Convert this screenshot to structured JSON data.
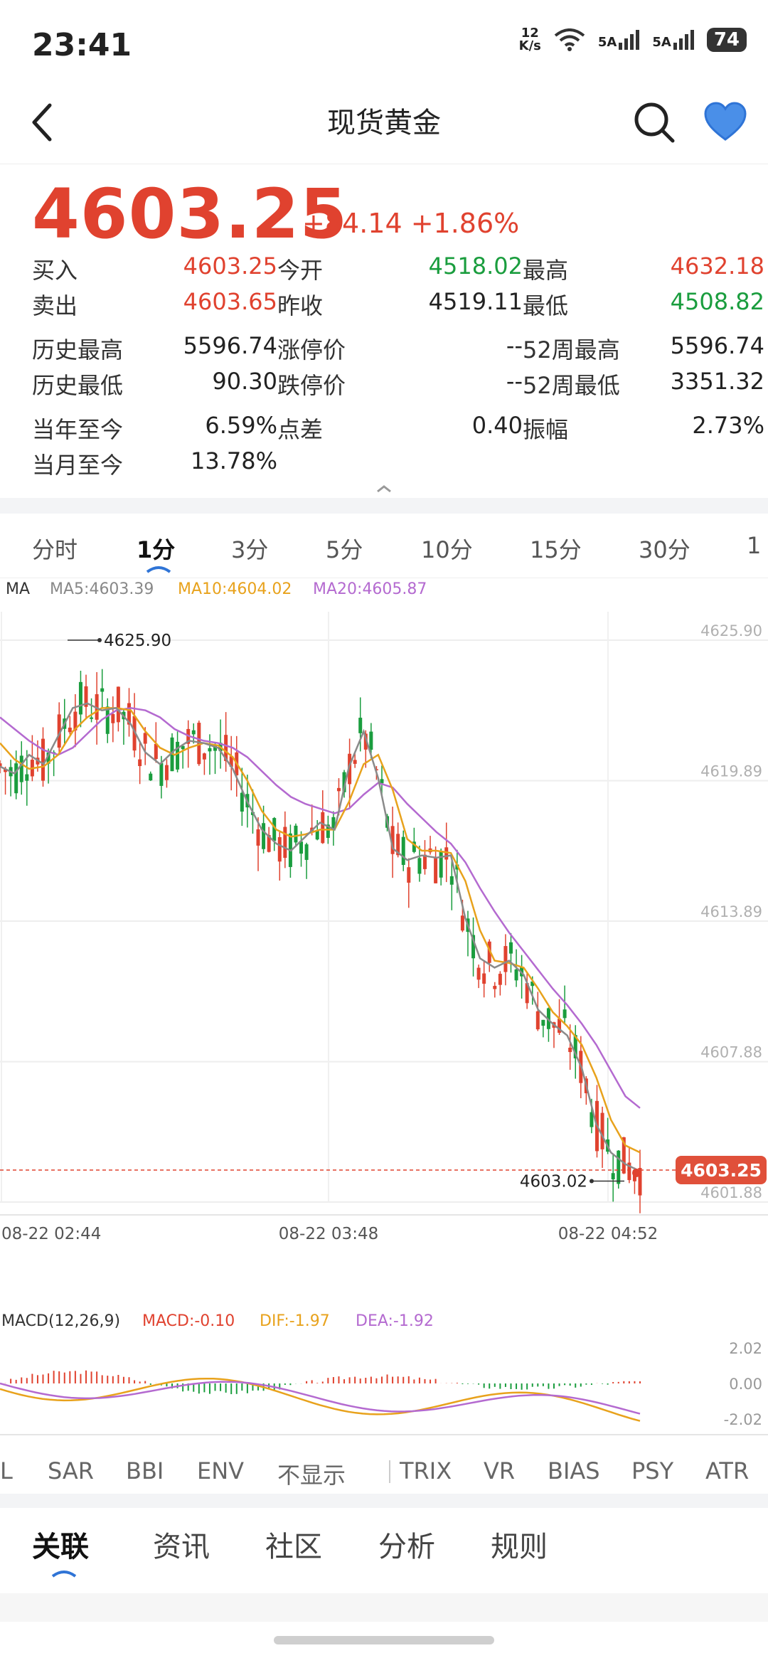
{
  "status_bar": {
    "time": "23:41",
    "net_speed": "12\nK/s",
    "signal1": "5A",
    "signal2": "5A",
    "battery": "74"
  },
  "header": {
    "title": "现货黄金"
  },
  "quote": {
    "price": "4603.25",
    "change": "+84.14 +1.86%",
    "colors": {
      "up": "#e0422f",
      "down": "#1a9d3e"
    },
    "stats": [
      [
        {
          "label": "买入",
          "value": "4603.25",
          "color": "red"
        },
        {
          "label": "今开",
          "value": "4518.02",
          "color": "green"
        },
        {
          "label": "最高",
          "value": "4632.18",
          "color": "red"
        }
      ],
      [
        {
          "label": "卖出",
          "value": "4603.65",
          "color": "red"
        },
        {
          "label": "昨收",
          "value": "4519.11",
          "color": "blk"
        },
        {
          "label": "最低",
          "value": "4508.82",
          "color": "green"
        }
      ],
      [
        {
          "label": "历史最高",
          "value": "5596.74",
          "color": "blk"
        },
        {
          "label": "涨停价",
          "value": "--",
          "color": "blk"
        },
        {
          "label": "52周最高",
          "value": "5596.74",
          "color": "blk"
        }
      ],
      [
        {
          "label": "历史最低",
          "value": "90.30",
          "color": "blk"
        },
        {
          "label": "跌停价",
          "value": "--",
          "color": "blk"
        },
        {
          "label": "52周最低",
          "value": "3351.32",
          "color": "blk"
        }
      ],
      [
        {
          "label": "当年至今",
          "value": "6.59%",
          "color": "blk"
        },
        {
          "label": "点差",
          "value": "0.40",
          "color": "blk"
        },
        {
          "label": "振幅",
          "value": "2.73%",
          "color": "blk"
        }
      ],
      [
        {
          "label": "当月至今",
          "value": "13.78%",
          "color": "blk"
        }
      ]
    ]
  },
  "period_tabs": [
    "分时",
    "1分",
    "3分",
    "5分",
    "10分",
    "15分",
    "30分",
    "1"
  ],
  "period_active": "1分",
  "ma_legend": {
    "label": "MA",
    "ma5": "MA5:4603.39",
    "ma10": "MA10:4604.02",
    "ma20": "MA20:4605.87"
  },
  "chart_data": {
    "type": "candlestick",
    "y_ticks": [
      "4625.90",
      "4619.89",
      "4613.89",
      "4607.88",
      "4601.88"
    ],
    "x_ticks": [
      "08-22 02:44",
      "08-22 03:48",
      "08-22 04:52"
    ],
    "high_label": "4625.90",
    "low_label": "4603.02",
    "current_label": "4603.25",
    "ylim": [
      4601.88,
      4625.9
    ],
    "ma5_series": [
      4620.5,
      4620.2,
      4621.0,
      4620.6,
      4621.8,
      4623.0,
      4623.2,
      4622.9,
      4623.0,
      4622.3,
      4621.1,
      4620.6,
      4621.2,
      4621.6,
      4621.5,
      4621.3,
      4620.4,
      4619.0,
      4617.8,
      4617.2,
      4616.9,
      4617.5,
      4618.1,
      4617.8,
      4620.5,
      4622.0,
      4620.0,
      4617.0,
      4616.5,
      4616.7,
      4616.6,
      4616.7,
      4614.0,
      4612.3,
      4611.9,
      4612.2,
      4611.6,
      4610.1,
      4609.5,
      4609.0,
      4607.6,
      4605.2,
      4604.0,
      4603.5,
      4603.2
    ],
    "ma10_series": [
      4621.5,
      4620.8,
      4620.4,
      4620.5,
      4621.0,
      4622.0,
      4622.6,
      4623.0,
      4623.0,
      4622.9,
      4622.0,
      4621.3,
      4621.0,
      4621.3,
      4621.5,
      4621.4,
      4620.9,
      4619.9,
      4618.6,
      4617.8,
      4617.5,
      4617.6,
      4617.8,
      4617.8,
      4619.0,
      4620.6,
      4621.0,
      4619.5,
      4617.4,
      4616.9,
      4616.9,
      4616.8,
      4615.6,
      4613.5,
      4612.2,
      4612.1,
      4611.9,
      4611.0,
      4610.0,
      4609.4,
      4608.6,
      4607.2,
      4605.4,
      4604.3,
      4604.0
    ],
    "ma20_series": [
      4622.6,
      4622.1,
      4621.6,
      4621.2,
      4621.0,
      4621.3,
      4621.9,
      4622.5,
      4622.9,
      4623.0,
      4622.9,
      4622.6,
      4622.1,
      4621.8,
      4621.6,
      4621.5,
      4621.3,
      4620.9,
      4620.3,
      4619.7,
      4619.2,
      4618.9,
      4618.7,
      4618.5,
      4618.7,
      4619.3,
      4619.8,
      4619.6,
      4618.9,
      4618.3,
      4617.7,
      4617.2,
      4616.4,
      4615.3,
      4614.3,
      4613.4,
      4612.6,
      4611.8,
      4611.0,
      4610.3,
      4609.5,
      4608.6,
      4607.5,
      4606.4,
      4605.9
    ],
    "macd_legend": {
      "name": "MACD(12,26,9)",
      "macd": "MACD:-0.10",
      "dif": "DIF:-1.97",
      "dea": "DEA:-1.92"
    },
    "macd_ticks": [
      "2.02",
      "0.00",
      "-2.02"
    ]
  },
  "indicator_tabs": [
    "L",
    "SAR",
    "BBI",
    "ENV",
    "不显示",
    "TRIX",
    "VR",
    "BIAS",
    "PSY",
    "ATR"
  ],
  "bottom_tabs": [
    "关联",
    "资讯",
    "社区",
    "分析",
    "规则"
  ],
  "bottom_active": "关联"
}
